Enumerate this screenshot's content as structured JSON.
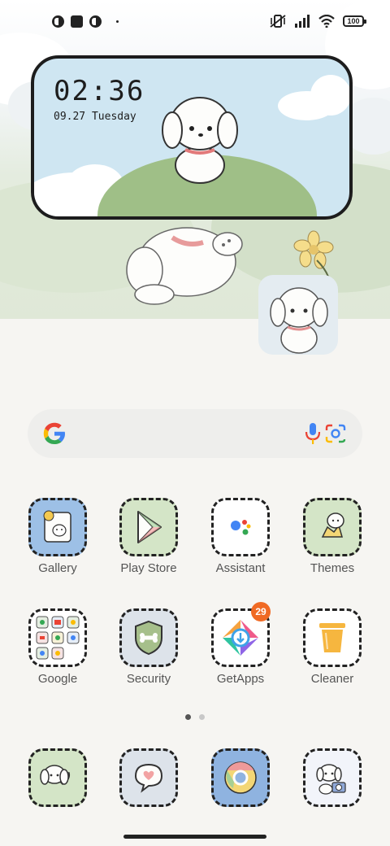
{
  "status_bar": {
    "battery": "100",
    "icons": [
      "notification-app-icon",
      "notification-square-icon",
      "notification-app-icon",
      "more-notifications-dot",
      "vibrate-icon",
      "signal-icon",
      "wifi-icon",
      "battery-icon"
    ]
  },
  "clock_widget": {
    "time": "02:36",
    "date": "09.27 Tuesday"
  },
  "search": {
    "icons": [
      "google-g-icon",
      "microphone-icon",
      "google-lens-icon"
    ]
  },
  "apps": [
    {
      "label": "Gallery",
      "icon": "gallery-icon"
    },
    {
      "label": "Play Store",
      "icon": "play-store-icon"
    },
    {
      "label": "Assistant",
      "icon": "assistant-icon"
    },
    {
      "label": "Themes",
      "icon": "themes-icon"
    },
    {
      "label": "Google",
      "icon": "google-folder-icon"
    },
    {
      "label": "Security",
      "icon": "security-icon"
    },
    {
      "label": "GetApps",
      "icon": "getapps-icon",
      "badge": "29"
    },
    {
      "label": "Cleaner",
      "icon": "cleaner-icon"
    }
  ],
  "dock": [
    {
      "icon": "phone-icon"
    },
    {
      "icon": "messages-icon"
    },
    {
      "icon": "chrome-icon"
    },
    {
      "icon": "camera-icon"
    }
  ],
  "pager": {
    "pages": 2,
    "active": 1
  },
  "colors": {
    "accent_badge": "#f06a24",
    "widget_sky": "#cfe6f2",
    "widget_hill": "#9fbf87"
  }
}
